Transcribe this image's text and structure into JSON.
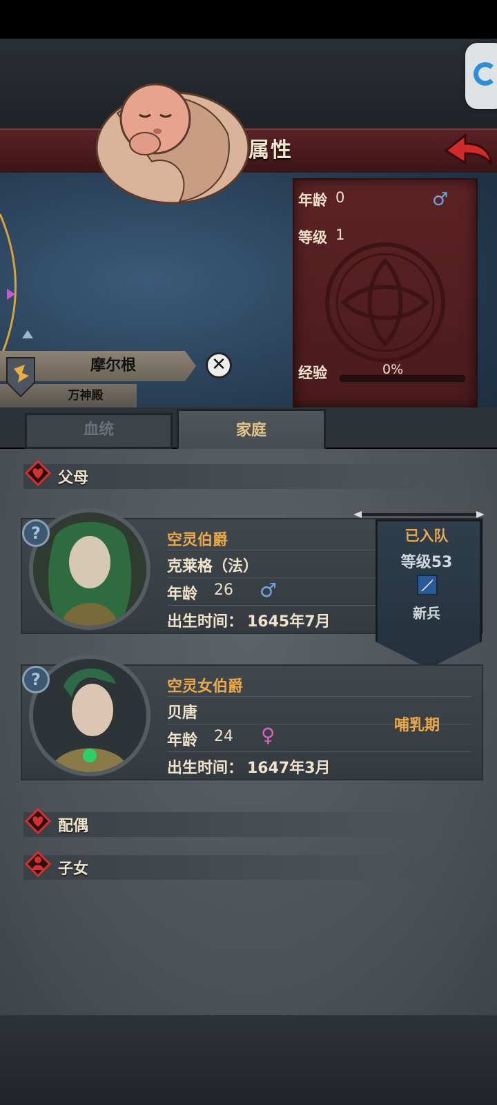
{
  "header": {
    "title": "角色属性"
  },
  "hero": {
    "name": "摩尔根",
    "guild": "万神殿",
    "stats": {
      "age_label": "年龄",
      "age_value": "0",
      "level_label": "等级",
      "level_value": "1",
      "exp_label": "经验",
      "exp_value": "0%",
      "exp_fraction": 0
    },
    "gender": "male"
  },
  "tabs": [
    {
      "label": "血统",
      "active": false
    },
    {
      "label": "家庭",
      "active": true
    }
  ],
  "sections": {
    "parents": "父母",
    "spouse": "配偶",
    "children": "子女"
  },
  "parents": [
    {
      "title": "空灵伯爵",
      "name": "克莱格（法）",
      "age_label": "年龄",
      "age": "26",
      "gender": "male",
      "birth_label": "出生时间：",
      "birth": "1645年7月",
      "status": {
        "joined": "已入队",
        "level_label": "等级",
        "level": "53",
        "rank": "新兵"
      }
    },
    {
      "title": "空灵女伯爵",
      "name": "贝唐",
      "age_label": "年龄",
      "age": "24",
      "gender": "female",
      "birth_label": "出生时间：",
      "birth": "1647年3月",
      "status_text": "哺乳期"
    }
  ],
  "colors": {
    "accent": "#eba94a",
    "header": "#5a2226",
    "male": "#6ea6e0",
    "female": "#e060c0"
  }
}
